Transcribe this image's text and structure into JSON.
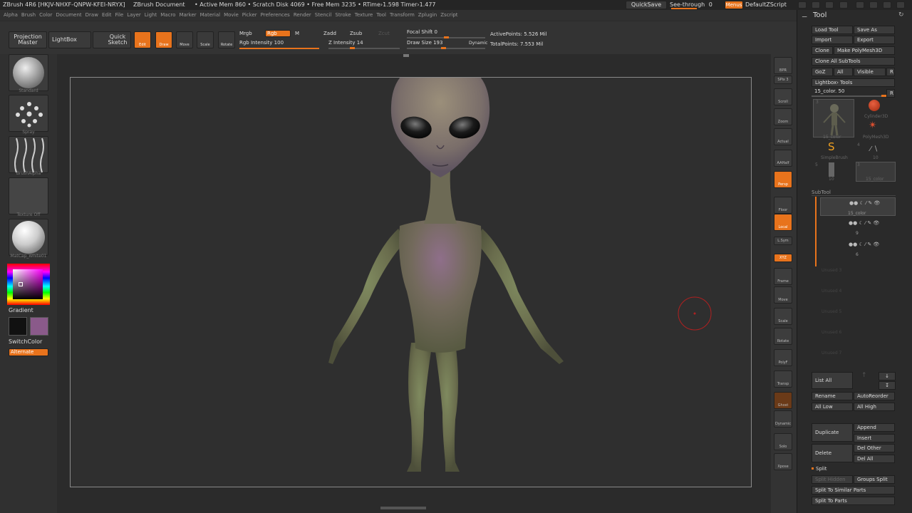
{
  "titlebar": {
    "app": "ZBrush 4R6 [HKJV-NHXF-QNPW-KFEI-NRYX]",
    "doc": "ZBrush Document",
    "stats": "• Active Mem 860 • Scratch Disk 4069 • Free Mem 3235 • RTime›1.598 Timer›1.477",
    "quicksave": "QuickSave",
    "see_through": "See-through",
    "see_through_value": "0",
    "menus": "Menus",
    "zscript": "DefaultZScript"
  },
  "menu": [
    "Alpha",
    "Brush",
    "Color",
    "Document",
    "Draw",
    "Edit",
    "File",
    "Layer",
    "Light",
    "Macro",
    "Marker",
    "Material",
    "Movie",
    "Picker",
    "Preferences",
    "Render",
    "Stencil",
    "Stroke",
    "Texture",
    "Tool",
    "Transform",
    "Zplugin",
    "Zscript"
  ],
  "shelf": {
    "projection_master": "Projection Master",
    "lightbox": "LightBox",
    "quick_sketch": "Quick Sketch",
    "edit": "Edit",
    "draw": "Draw",
    "move": "Move",
    "scale": "Scale",
    "rotate": "Rotate",
    "mrgb": "Mrgb",
    "rgb": "Rgb",
    "m": "M",
    "rgb_intensity": "Rgb Intensity 100",
    "zadd": "Zadd",
    "zsub": "Zsub",
    "zcut": "Zcut",
    "z_intensity": "Z Intensity 14",
    "focal_shift": "Focal Shift 0",
    "draw_size": "Draw Size 193",
    "dynamic": "Dynamic",
    "active_points": "ActivePoints: 5.526 Mil",
    "total_points": "TotalPoints: 7.553 Mil"
  },
  "left": {
    "brush": "Standard",
    "stroke": "Spray",
    "alpha": "BrushAlpha",
    "texture": "Texture Off",
    "material": "MatCap_White01",
    "gradient": "Gradient",
    "switch_color": "SwitchColor",
    "alternate": "Alternate",
    "main_color": "#111111",
    "secondary_color": "#8a5a8a"
  },
  "right_shelf": [
    "BPR",
    "SPix 3",
    "Scroll",
    "Zoom",
    "Actual",
    "AAHalf",
    "Persp",
    "Floor",
    "Local",
    "L.Sym",
    "XYZ",
    "Frame",
    "Move",
    "Scale",
    "Rotate",
    "PolyF",
    "Transp",
    "Ghost",
    "Dynamic",
    "Solo",
    "Xpose"
  ],
  "tool": {
    "title": "Tool",
    "load_tool": "Load Tool",
    "save_as": "Save As",
    "import": "Import",
    "export": "Export",
    "clone": "Clone",
    "make_polymesh": "Make PolyMesh3D",
    "clone_all": "Clone All SubTools",
    "goz": "GoZ",
    "all": "All",
    "visible": "Visible",
    "r": "R",
    "lightbox_tools": "Lightbox› Tools",
    "current_tool": "15_color. 50",
    "thumbs": [
      "15_color",
      "Cylinder3D",
      "PolyMesh3D",
      "SimpleBrush",
      "10",
      "10",
      "15_color"
    ],
    "thumb_counts": [
      "3",
      "4",
      "5",
      "3"
    ],
    "subtool_header": "SubTool",
    "subtools": [
      "15_color",
      "9",
      "6"
    ],
    "empty_slots": [
      "Unused 3",
      "Unused 4",
      "Unused 5",
      "Unused 6",
      "Unused 7"
    ],
    "list_all": "List All",
    "rename": "Rename",
    "auto_reorder": "AutoReorder",
    "all_low": "All Low",
    "all_high": "All High",
    "append": "Append",
    "duplicate": "Duplicate",
    "insert": "Insert",
    "del_other": "Del Other",
    "delete": "Delete",
    "del_all": "Del All",
    "split": "Split",
    "split_hidden": "Split Hidden",
    "groups_split": "Groups Split",
    "split_similar": "Split To Similar Parts",
    "split_parts": "Split To Parts"
  }
}
